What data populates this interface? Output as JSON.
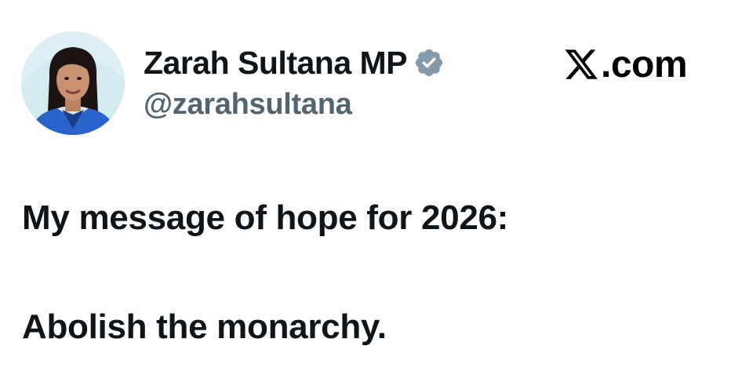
{
  "author": {
    "display_name": "Zarah Sultana MP",
    "handle": "@zarahsultana",
    "verified": true,
    "avatar_icon": "profile-photo"
  },
  "brand": {
    "logo_icon": "x-logo-icon",
    "text": ".com"
  },
  "tweet": {
    "lines": [
      "My message of hope for 2026:",
      "Abolish the monarchy."
    ]
  },
  "colors": {
    "text_primary": "#0f1419",
    "text_secondary": "#536471",
    "verified_badge": "#829aab",
    "background": "#ffffff"
  }
}
